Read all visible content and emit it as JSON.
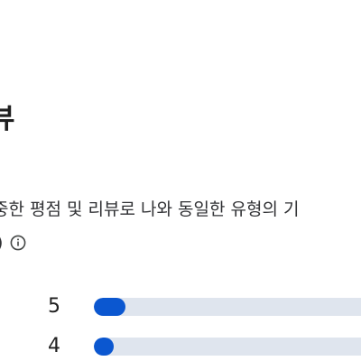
{
  "header": {
    "title_fragment": "뷰"
  },
  "description": {
    "text_fragment": "중한 평점 및 리뷰로 나와 동일한 유형의 기",
    "tail_fragment": ")",
    "info_icon": "info-circle-icon"
  },
  "ratings": [
    {
      "stars": "5",
      "fill_fraction": 0.11
    },
    {
      "stars": "4",
      "fill_fraction": 0.07
    }
  ],
  "colors": {
    "accent": "#0b57d0",
    "track": "#dfe5ee",
    "text": "#1f1f1f"
  }
}
